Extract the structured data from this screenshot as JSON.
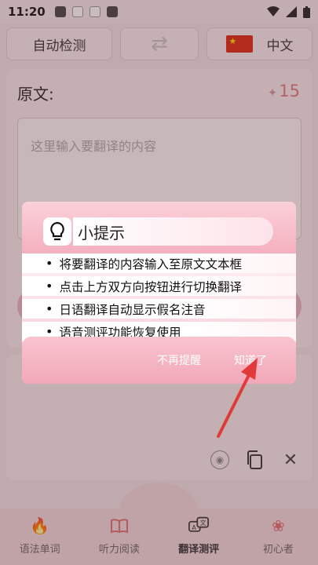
{
  "status_bar": {
    "time": "11:20"
  },
  "lang_bar": {
    "source_label": "自动检测",
    "swap_icon": "swap-arrows-icon",
    "target_label": "中文"
  },
  "source_panel": {
    "title": "原文:",
    "char_count": "15",
    "placeholder": "这里输入要翻译的内容"
  },
  "tip_dialog": {
    "title": "小提示",
    "tips": [
      "将要翻译的内容输入至原文文本框",
      "点击上方双方向按钮进行切换翻译",
      "日语翻译自动显示假名注音",
      "语音测评功能恢复使用"
    ],
    "dismiss_forever_label": "不再提醒",
    "ok_label": "知道了"
  },
  "bottom_nav": {
    "items": [
      {
        "label": "语法单词",
        "icon": "flame-icon"
      },
      {
        "label": "听力阅读",
        "icon": "book-icon"
      },
      {
        "label": "翻译测评",
        "icon": "translate-icon"
      },
      {
        "label": "初心者",
        "icon": "sakura-icon"
      }
    ],
    "active_index": 2
  },
  "colors": {
    "accent_pink": "#f3b1bf",
    "arrow_red": "#e23a3a",
    "count_red": "#e07a7a"
  }
}
